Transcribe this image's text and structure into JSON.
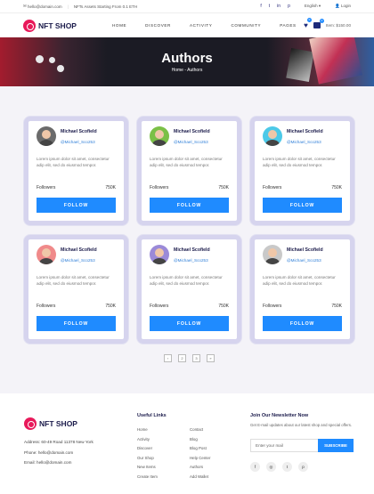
{
  "topbar": {
    "email": "hello@domain.com",
    "announcement": "NFTs Assets Starting From 0.1 ETH",
    "social": [
      "f",
      "t",
      "in",
      "p"
    ],
    "language": "English",
    "login": "Login"
  },
  "nav": {
    "logo": "NFT SHOP",
    "menu": [
      "HOME",
      "DISCOVER",
      "ACTIVITY",
      "COMMUNITY",
      "PAGES"
    ],
    "wishlist_count": "0",
    "cart_count": "0",
    "cart_total": "Item: $150.00"
  },
  "hero": {
    "title": "Authors",
    "breadcrumb": "Home - Authors"
  },
  "authors": [
    {
      "name": "Michael Scofield",
      "handle": "@Michael_Sco253",
      "bio": "Lorem ipsum dolor sit amet, consectetur adip elit, sed do eiusmod tempor.",
      "followers_label": "Followers",
      "followers": "750K",
      "button": "FOLLOW",
      "avatar_color": "#6b6b6b"
    },
    {
      "name": "Michael Scofield",
      "handle": "@Michael_Sco253",
      "bio": "Lorem ipsum dolor sit amet, consectetur adip elit, sed do eiusmod tempor.",
      "followers_label": "Followers",
      "followers": "750K",
      "button": "FOLLOW",
      "avatar_color": "#7bc047"
    },
    {
      "name": "Michael Scofield",
      "handle": "@Michael_Sco253",
      "bio": "Lorem ipsum dolor sit amet, consectetur adip elit, sed do eiusmod tempor.",
      "followers_label": "Followers",
      "followers": "750K",
      "button": "FOLLOW",
      "avatar_color": "#4cc9e8"
    },
    {
      "name": "Michael Scofield",
      "handle": "@Michael_Sco253",
      "bio": "Lorem ipsum dolor sit amet, consectetur adip elit, sed do eiusmod tempor.",
      "followers_label": "Followers",
      "followers": "750K",
      "button": "FOLLOW",
      "avatar_color": "#f08a8a"
    },
    {
      "name": "Michael Scofield",
      "handle": "@Michael_Sco253",
      "bio": "Lorem ipsum dolor sit amet, consectetur adip elit, sed do eiusmod tempor.",
      "followers_label": "Followers",
      "followers": "750K",
      "button": "FOLLOW",
      "avatar_color": "#9b8ad8"
    },
    {
      "name": "Michael Scofield",
      "handle": "@Michael_Sco253",
      "bio": "Lorem ipsum dolor sit amet, consectetur adip elit, sed do eiusmod tempor.",
      "followers_label": "Followers",
      "followers": "750K",
      "button": "FOLLOW",
      "avatar_color": "#c9c9c9"
    }
  ],
  "pagination": [
    "‹",
    "2",
    "3",
    "»"
  ],
  "footer": {
    "logo": "NFT SHOP",
    "address": "Address: 60-49 Road 11378 New York",
    "phone": "Phone: hello@domain.com",
    "email": "Email: hello@domain.com",
    "useful_links_title": "Useful Links",
    "links_col1": [
      "Home",
      "Activity",
      "Discover",
      "Our Shop",
      "New Items",
      "Create Item"
    ],
    "links_col2": [
      "Contact",
      "Blog",
      "Blog Post",
      "Help Center",
      "Authors",
      "Add Wallet"
    ],
    "newsletter_title": "Join Our Newsletter Now",
    "newsletter_text": "Get E-mail updates about our latest shop and special offers.",
    "email_placeholder": "Enter your mail",
    "subscribe": "SUBSCRIBE",
    "social": [
      "f",
      "◎",
      "t",
      "p"
    ]
  },
  "colors": {
    "accent": "#1f8bff",
    "brand": "#e8195a",
    "navy": "#1b1b4b"
  }
}
